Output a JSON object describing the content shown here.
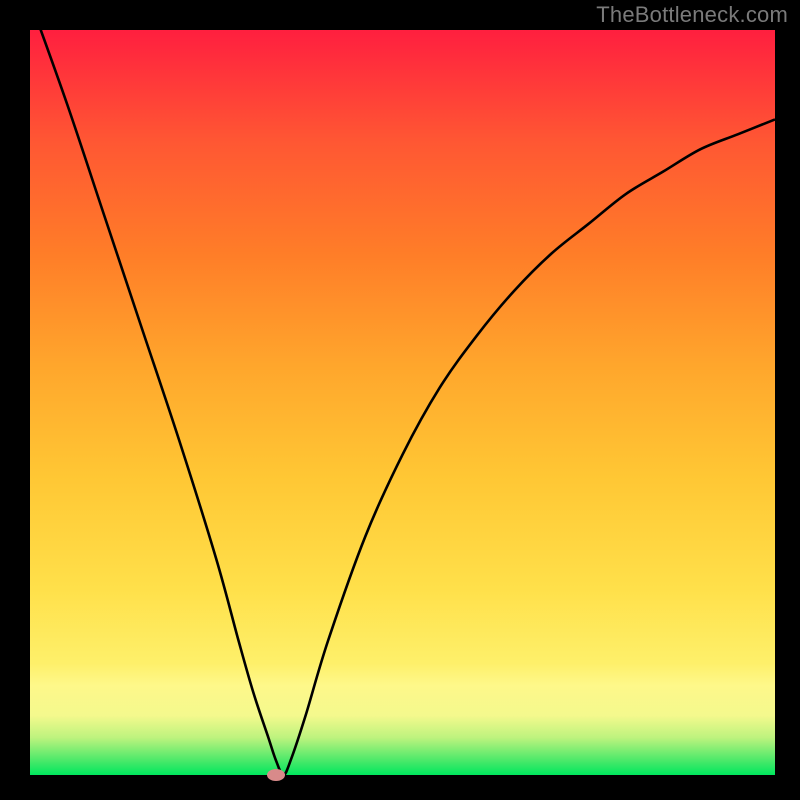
{
  "watermark": "TheBottleneck.com",
  "chart_data": {
    "type": "line",
    "title": "",
    "xlabel": "",
    "ylabel": "",
    "xlim": [
      0,
      100
    ],
    "ylim": [
      0,
      100
    ],
    "grid": false,
    "series": [
      {
        "name": "bottleneck-curve",
        "x": [
          0,
          5,
          10,
          15,
          20,
          25,
          28,
          30,
          32,
          33,
          34,
          35,
          37,
          40,
          45,
          50,
          55,
          60,
          65,
          70,
          75,
          80,
          85,
          90,
          95,
          100
        ],
        "y": [
          104,
          90,
          75,
          60,
          45,
          29,
          18,
          11,
          5,
          2,
          0,
          2,
          8,
          18,
          32,
          43,
          52,
          59,
          65,
          70,
          74,
          78,
          81,
          84,
          86,
          88
        ]
      }
    ],
    "marker": {
      "x": 33,
      "y": 0,
      "series": "bottleneck-curve"
    },
    "gradient_stops": [
      {
        "pct": 0,
        "color": "#00e75e"
      },
      {
        "pct": 2,
        "color": "#4de96a"
      },
      {
        "pct": 5,
        "color": "#bdf37e"
      },
      {
        "pct": 8,
        "color": "#f4f98d"
      },
      {
        "pct": 12,
        "color": "#fef88a"
      },
      {
        "pct": 15,
        "color": "#fef06a"
      },
      {
        "pct": 25,
        "color": "#ffe04a"
      },
      {
        "pct": 40,
        "color": "#ffc734"
      },
      {
        "pct": 55,
        "color": "#ffa62c"
      },
      {
        "pct": 70,
        "color": "#ff7d28"
      },
      {
        "pct": 85,
        "color": "#ff5733"
      },
      {
        "pct": 100,
        "color": "#ff1f3f"
      }
    ]
  }
}
